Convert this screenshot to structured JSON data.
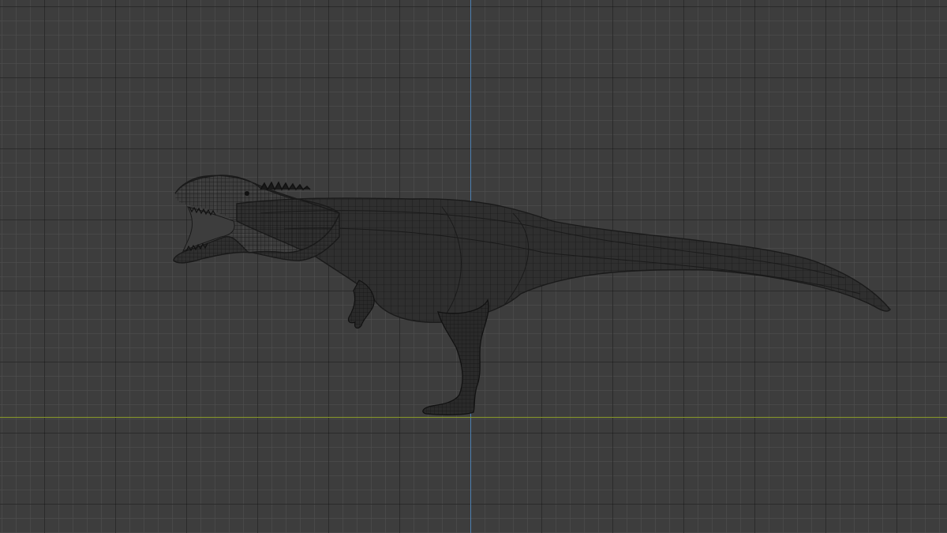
{
  "viewport": {
    "background_color": "#3d3d3d",
    "grid_minor_color": "#505050",
    "grid_major_color": "#2a2a2a"
  },
  "axes": {
    "vertical_axis_color": "#4d7fb0",
    "horizontal_axis_color": "#8a9a2a"
  },
  "model": {
    "display_mode": "wireframe",
    "wire_color": "#1c1c1c",
    "fill_color": "#2f2f2f"
  }
}
